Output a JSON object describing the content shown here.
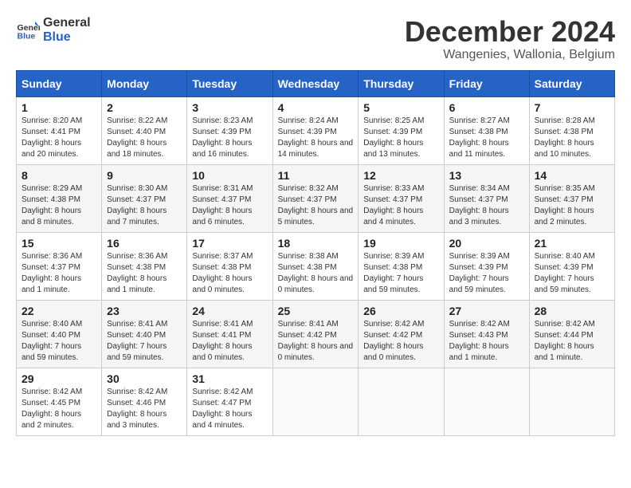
{
  "header": {
    "logo_line1": "General",
    "logo_line2": "Blue",
    "month_title": "December 2024",
    "location": "Wangenies, Wallonia, Belgium"
  },
  "weekdays": [
    "Sunday",
    "Monday",
    "Tuesday",
    "Wednesday",
    "Thursday",
    "Friday",
    "Saturday"
  ],
  "weeks": [
    [
      {
        "day": "1",
        "sunrise": "8:20 AM",
        "sunset": "4:41 PM",
        "daylight": "8 hours and 20 minutes."
      },
      {
        "day": "2",
        "sunrise": "8:22 AM",
        "sunset": "4:40 PM",
        "daylight": "8 hours and 18 minutes."
      },
      {
        "day": "3",
        "sunrise": "8:23 AM",
        "sunset": "4:39 PM",
        "daylight": "8 hours and 16 minutes."
      },
      {
        "day": "4",
        "sunrise": "8:24 AM",
        "sunset": "4:39 PM",
        "daylight": "8 hours and 14 minutes."
      },
      {
        "day": "5",
        "sunrise": "8:25 AM",
        "sunset": "4:39 PM",
        "daylight": "8 hours and 13 minutes."
      },
      {
        "day": "6",
        "sunrise": "8:27 AM",
        "sunset": "4:38 PM",
        "daylight": "8 hours and 11 minutes."
      },
      {
        "day": "7",
        "sunrise": "8:28 AM",
        "sunset": "4:38 PM",
        "daylight": "8 hours and 10 minutes."
      }
    ],
    [
      {
        "day": "8",
        "sunrise": "8:29 AM",
        "sunset": "4:38 PM",
        "daylight": "8 hours and 8 minutes."
      },
      {
        "day": "9",
        "sunrise": "8:30 AM",
        "sunset": "4:37 PM",
        "daylight": "8 hours and 7 minutes."
      },
      {
        "day": "10",
        "sunrise": "8:31 AM",
        "sunset": "4:37 PM",
        "daylight": "8 hours and 6 minutes."
      },
      {
        "day": "11",
        "sunrise": "8:32 AM",
        "sunset": "4:37 PM",
        "daylight": "8 hours and 5 minutes."
      },
      {
        "day": "12",
        "sunrise": "8:33 AM",
        "sunset": "4:37 PM",
        "daylight": "8 hours and 4 minutes."
      },
      {
        "day": "13",
        "sunrise": "8:34 AM",
        "sunset": "4:37 PM",
        "daylight": "8 hours and 3 minutes."
      },
      {
        "day": "14",
        "sunrise": "8:35 AM",
        "sunset": "4:37 PM",
        "daylight": "8 hours and 2 minutes."
      }
    ],
    [
      {
        "day": "15",
        "sunrise": "8:36 AM",
        "sunset": "4:37 PM",
        "daylight": "8 hours and 1 minute."
      },
      {
        "day": "16",
        "sunrise": "8:36 AM",
        "sunset": "4:38 PM",
        "daylight": "8 hours and 1 minute."
      },
      {
        "day": "17",
        "sunrise": "8:37 AM",
        "sunset": "4:38 PM",
        "daylight": "8 hours and 0 minutes."
      },
      {
        "day": "18",
        "sunrise": "8:38 AM",
        "sunset": "4:38 PM",
        "daylight": "8 hours and 0 minutes."
      },
      {
        "day": "19",
        "sunrise": "8:39 AM",
        "sunset": "4:38 PM",
        "daylight": "7 hours and 59 minutes."
      },
      {
        "day": "20",
        "sunrise": "8:39 AM",
        "sunset": "4:39 PM",
        "daylight": "7 hours and 59 minutes."
      },
      {
        "day": "21",
        "sunrise": "8:40 AM",
        "sunset": "4:39 PM",
        "daylight": "7 hours and 59 minutes."
      }
    ],
    [
      {
        "day": "22",
        "sunrise": "8:40 AM",
        "sunset": "4:40 PM",
        "daylight": "7 hours and 59 minutes."
      },
      {
        "day": "23",
        "sunrise": "8:41 AM",
        "sunset": "4:40 PM",
        "daylight": "7 hours and 59 minutes."
      },
      {
        "day": "24",
        "sunrise": "8:41 AM",
        "sunset": "4:41 PM",
        "daylight": "8 hours and 0 minutes."
      },
      {
        "day": "25",
        "sunrise": "8:41 AM",
        "sunset": "4:42 PM",
        "daylight": "8 hours and 0 minutes."
      },
      {
        "day": "26",
        "sunrise": "8:42 AM",
        "sunset": "4:42 PM",
        "daylight": "8 hours and 0 minutes."
      },
      {
        "day": "27",
        "sunrise": "8:42 AM",
        "sunset": "4:43 PM",
        "daylight": "8 hours and 1 minute."
      },
      {
        "day": "28",
        "sunrise": "8:42 AM",
        "sunset": "4:44 PM",
        "daylight": "8 hours and 1 minute."
      }
    ],
    [
      {
        "day": "29",
        "sunrise": "8:42 AM",
        "sunset": "4:45 PM",
        "daylight": "8 hours and 2 minutes."
      },
      {
        "day": "30",
        "sunrise": "8:42 AM",
        "sunset": "4:46 PM",
        "daylight": "8 hours and 3 minutes."
      },
      {
        "day": "31",
        "sunrise": "8:42 AM",
        "sunset": "4:47 PM",
        "daylight": "8 hours and 4 minutes."
      },
      null,
      null,
      null,
      null
    ]
  ],
  "labels": {
    "sunrise": "Sunrise:",
    "sunset": "Sunset:",
    "daylight": "Daylight:"
  }
}
